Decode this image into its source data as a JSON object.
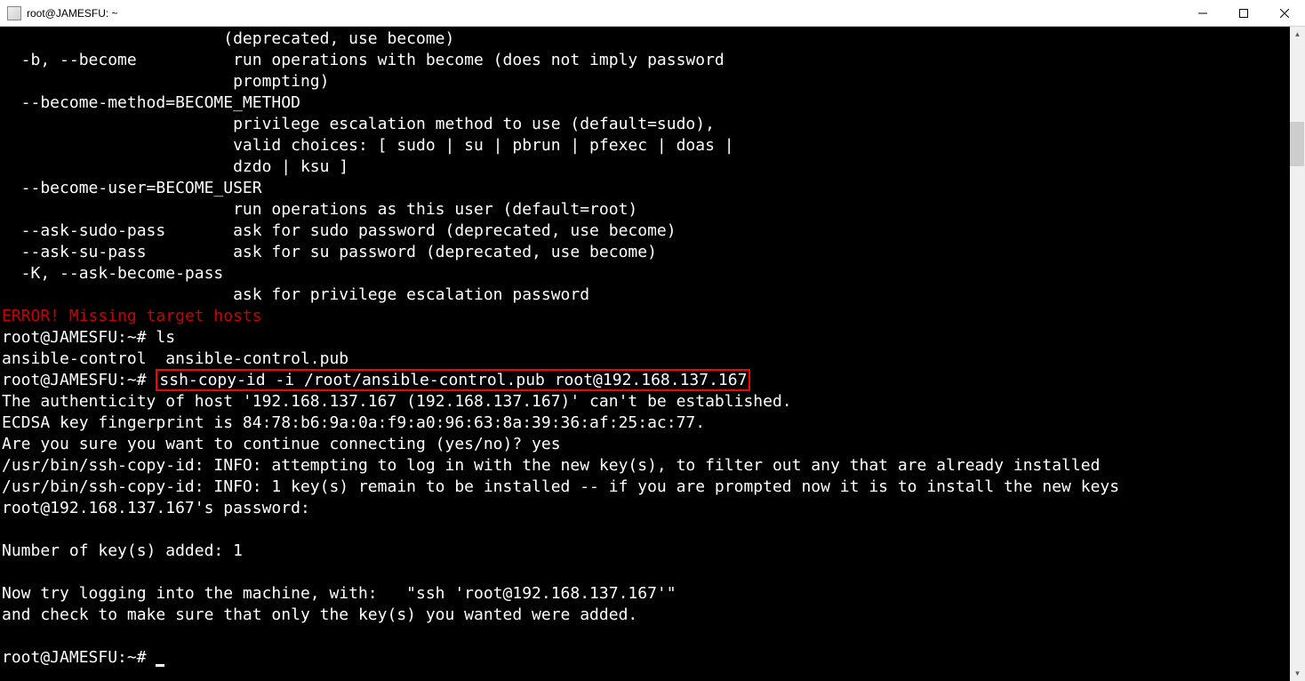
{
  "window": {
    "title": "root@JAMESFU: ~"
  },
  "terminal": {
    "lines": {
      "l1": "                       (deprecated, use become)",
      "l2": "  -b, --become          run operations with become (does not imply password",
      "l3": "                        prompting)",
      "l4": "  --become-method=BECOME_METHOD",
      "l5": "                        privilege escalation method to use (default=sudo),",
      "l6": "                        valid choices: [ sudo | su | pbrun | pfexec | doas |",
      "l7": "                        dzdo | ksu ]",
      "l8": "  --become-user=BECOME_USER",
      "l9": "                        run operations as this user (default=root)",
      "l10": "  --ask-sudo-pass       ask for sudo password (deprecated, use become)",
      "l11": "  --ask-su-pass         ask for su password (deprecated, use become)",
      "l12": "  -K, --ask-become-pass",
      "l13": "                        ask for privilege escalation password",
      "error": "ERROR! Missing target hosts",
      "prompt1": "root@JAMESFU:~# ",
      "cmd1": "ls",
      "ls_output": "ansible-control  ansible-control.pub",
      "prompt2": "root@JAMESFU:~# ",
      "highlighted_cmd": "ssh-copy-id -i /root/ansible-control.pub root@192.168.137.167",
      "l18": "The authenticity of host '192.168.137.167 (192.168.137.167)' can't be established.",
      "l19": "ECDSA key fingerprint is 84:78:b6:9a:0a:f9:a0:96:63:8a:39:36:af:25:ac:77.",
      "l20": "Are you sure you want to continue connecting (yes/no)? yes",
      "l21": "/usr/bin/ssh-copy-id: INFO: attempting to log in with the new key(s), to filter out any that are already installed",
      "l22": "/usr/bin/ssh-copy-id: INFO: 1 key(s) remain to be installed -- if you are prompted now it is to install the new keys",
      "l23": "root@192.168.137.167's password:",
      "l25": "Number of key(s) added: 1",
      "l27": "Now try logging into the machine, with:   \"ssh 'root@192.168.137.167'\"",
      "l28": "and check to make sure that only the key(s) you wanted were added.",
      "prompt3": "root@JAMESFU:~# "
    }
  }
}
